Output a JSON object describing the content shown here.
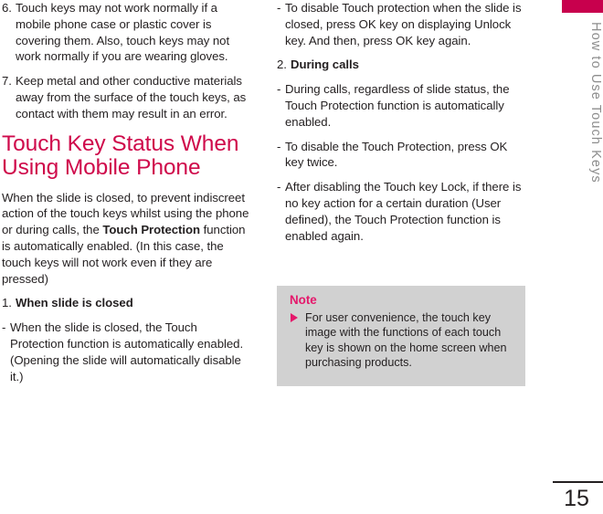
{
  "page": {
    "number": "15",
    "tab_label": "How to Use Touch Keys",
    "accent_color": "#cf0a4b",
    "tab_color": "#c8004d",
    "note_bg_color": "#d1d1d1",
    "body_color": "#231f20"
  },
  "left_column": {
    "items": [
      {
        "marker": "6.",
        "text": "Touch keys may not work normally if a mobile phone case or plastic cover is covering them. Also, touch keys may not work normally if you are wearing gloves."
      },
      {
        "marker": "7.",
        "text": "Keep metal and other conductive materials away from the surface of the touch keys, as contact with them may result in an error."
      }
    ],
    "heading": "Touch Key Status When Using Mobile Phone",
    "intro": {
      "part1": "When the slide is closed, to prevent indiscreet action of the touch keys whilst using the phone or during calls, the ",
      "bold1": "Touch Protection",
      "part2": " function is automatically enabled. (In this case, the touch keys will not work even if they are pressed)"
    },
    "step1": {
      "marker": "1.",
      "label": "When slide is closed"
    },
    "step1_bullets": [
      {
        "marker": "-",
        "text": "When the slide is closed, the Touch Protection function is automatically enabled. (Opening the slide will automatically disable it.)"
      }
    ]
  },
  "right_column": {
    "step1_bullets_continued": [
      {
        "marker": "-",
        "text": "To disable Touch protection when the slide is closed, press OK key on displaying Unlock key. And then, press OK key again."
      }
    ],
    "step2": {
      "marker": "2.",
      "label": "During calls"
    },
    "step2_bullets": [
      {
        "marker": "-",
        "text": "During calls, regardless of slide status, the Touch Protection function is automatically enabled."
      },
      {
        "marker": "-",
        "text": "To disable the Touch Protection, press OK key twice."
      },
      {
        "marker": "-",
        "text": "After disabling the Touch key Lock, if there is no key action for a certain duration (User defined), the Touch Protection function is enabled again."
      }
    ]
  },
  "note": {
    "title": "Note",
    "bullet_icon": "triangle-right-icon",
    "items": [
      "For user convenience, the touch key image with the functions of each touch key is shown on the home screen when purchasing products."
    ]
  }
}
